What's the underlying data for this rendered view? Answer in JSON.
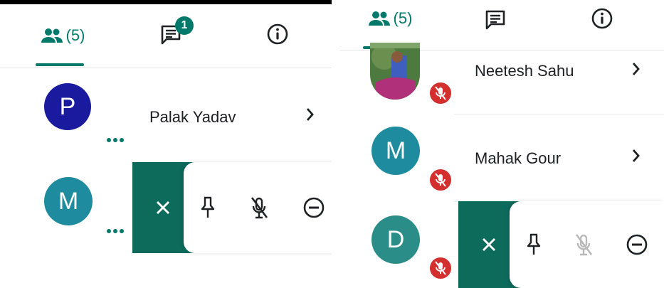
{
  "left": {
    "tabs": {
      "people_count": "(5)",
      "chat_badge": "1"
    },
    "participants": [
      {
        "initial": "P",
        "name": "Palak Yadav",
        "color": "#1a1a9e"
      },
      {
        "initial": "M",
        "name": "",
        "color": "#1e8c9e"
      }
    ],
    "action_bar": {
      "close_label": "×"
    }
  },
  "right": {
    "tabs": {
      "people_count": "(5)"
    },
    "participants": [
      {
        "initial": "",
        "name": "Neetesh Sahu",
        "photo": true
      },
      {
        "initial": "M",
        "name": "Mahak Gour",
        "color": "#1e8c9e"
      },
      {
        "initial": "D",
        "name": "",
        "color": "#2a8d88"
      }
    ],
    "action_bar": {
      "close_label": "×"
    }
  },
  "colors": {
    "accent": "#00796b",
    "mute": "#d32f2f",
    "close_bg": "#0d6b5c"
  },
  "icons": [
    "people-icon",
    "chat-icon",
    "info-icon",
    "chevron-right-icon",
    "more-dots-icon",
    "pin-icon",
    "mic-off-icon",
    "remove-icon",
    "close-icon"
  ]
}
